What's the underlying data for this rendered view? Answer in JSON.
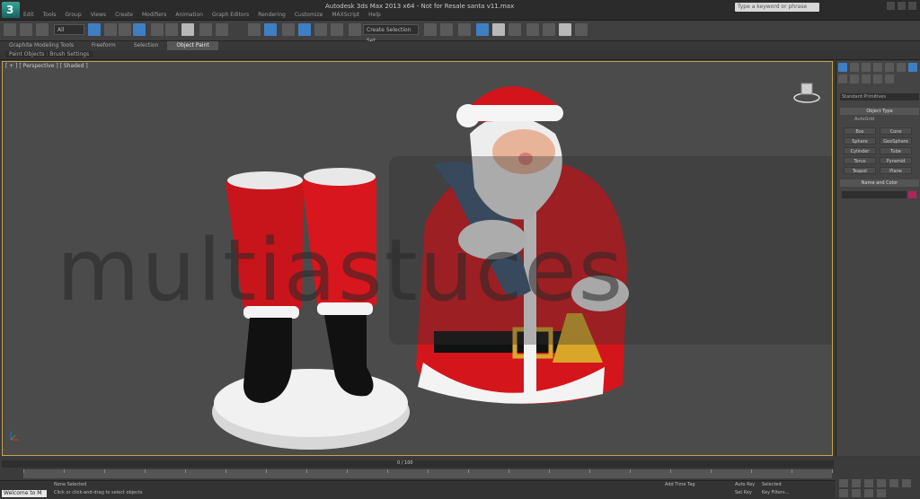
{
  "app": {
    "title": "Autodesk 3ds Max 2013 x64 - Not for Resale santa v11.max",
    "logo_letter": "3",
    "menu": [
      "Edit",
      "Tools",
      "Group",
      "Views",
      "Create",
      "Modifiers",
      "Animation",
      "Graph Editors",
      "Rendering",
      "Customize",
      "MAXScript",
      "Help"
    ],
    "search_placeholder": "Type a keyword or phrase"
  },
  "toolbar": {
    "selection_filter": "All",
    "named_selection": "Create Selection Set"
  },
  "ribbon": {
    "tabs": [
      "Graphite Modeling Tools",
      "Freeform",
      "Selection",
      "Object Paint"
    ],
    "active_tab": "Object Paint",
    "sub_tab": "Paint Objects : Brush Settings"
  },
  "viewport": {
    "label": "[ + ] [ Perspective ] [ Shaded ]",
    "watermark": "multiastuces"
  },
  "command_panel": {
    "category": "Standard Primitives",
    "rollout_object_type": "Object Type",
    "autogrid": "AutoGrid",
    "buttons": [
      "Box",
      "Cone",
      "Sphere",
      "GeoSphere",
      "Cylinder",
      "Tube",
      "Torus",
      "Pyramid",
      "Teapot",
      "Plane"
    ],
    "rollout_name_color": "Name and Color",
    "swatch_color": "#b0245a"
  },
  "timeline": {
    "frame_label": "0 / 100",
    "ticks": [
      "0",
      "5",
      "10",
      "15",
      "20",
      "25",
      "30",
      "35",
      "40",
      "45",
      "50",
      "55",
      "60",
      "65",
      "70",
      "75",
      "80",
      "85",
      "90",
      "95",
      "100"
    ]
  },
  "status": {
    "maxscript": "Welcome to M",
    "selection": "None Selected",
    "prompt": "Click or click-and-drag to select objects",
    "add_time_tag": "Add Time Tag",
    "auto_key": "Auto Key",
    "selected": "Selected",
    "set_key": "Set Key",
    "key_filters": "Key Filters..."
  },
  "colors": {
    "viewport_border": "#c8a24a",
    "accent": "#3e7fc4"
  }
}
